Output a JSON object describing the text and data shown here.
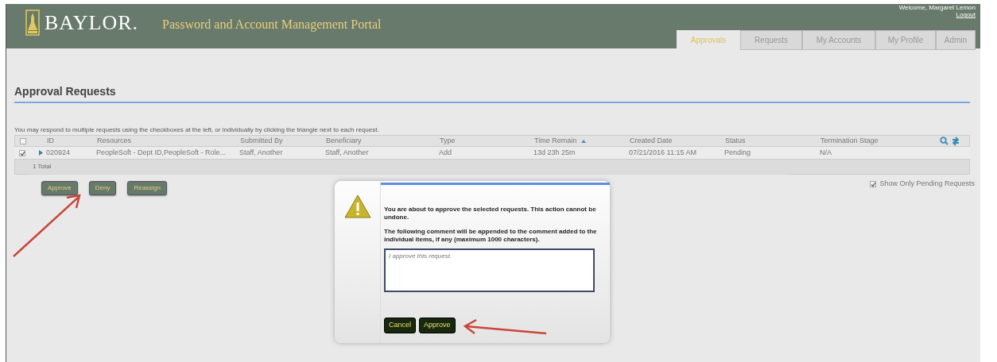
{
  "header": {
    "logo_text": "BAYLOR.",
    "title": "Password and Account Management Portal",
    "welcome": "Welcome, Margaret Lemon",
    "logout": "Logout"
  },
  "tabs": [
    {
      "label": "Approvals",
      "selected": true
    },
    {
      "label": "Requests",
      "selected": false
    },
    {
      "label": "My Accounts",
      "selected": false
    },
    {
      "label": "My Profile",
      "selected": false
    },
    {
      "label": "Admin",
      "selected": false
    }
  ],
  "section_title": "Approval Requests",
  "instructions": "You may respond to multiple requests using the checkboxes at the left, or individually by clicking the triangle next to each request.",
  "table": {
    "all_checked": false,
    "columns": [
      {
        "label": "ID",
        "sorted": false
      },
      {
        "label": "Resources",
        "sorted": false
      },
      {
        "label": "Submitted By",
        "sorted": false
      },
      {
        "label": "Beneficiary",
        "sorted": false
      },
      {
        "label": "Type",
        "sorted": false
      },
      {
        "label": "Time Remain",
        "sorted": true
      },
      {
        "label": "Created Date",
        "sorted": false
      },
      {
        "label": "Status",
        "sorted": false
      },
      {
        "label": "Termination Stage",
        "sorted": false
      }
    ],
    "rows": [
      {
        "checked": true,
        "expanded": false,
        "cells": [
          "020924",
          "PeopleSoft - Dept ID,PeopleSoft - Role...",
          "Staff, Another",
          "Staff, Another",
          "Add",
          "13d 23h 25m",
          "07/21/2016 11:15 AM",
          "Pending",
          "N/A"
        ]
      }
    ],
    "total": "1 Total"
  },
  "actions": [
    "Approve",
    "Deny",
    "Reassign"
  ],
  "pending_filter": {
    "label": "Show Only Pending Requests",
    "checked": true
  },
  "dialog": {
    "message": "You are about to approve the selected requests. This action cannot be undone.",
    "note": "The following comment will be appended to the comment added to the individual items, if any (maximum 1000 characters).",
    "comment": "I approve this request.",
    "buttons": [
      "Cancel",
      "Approve"
    ]
  }
}
